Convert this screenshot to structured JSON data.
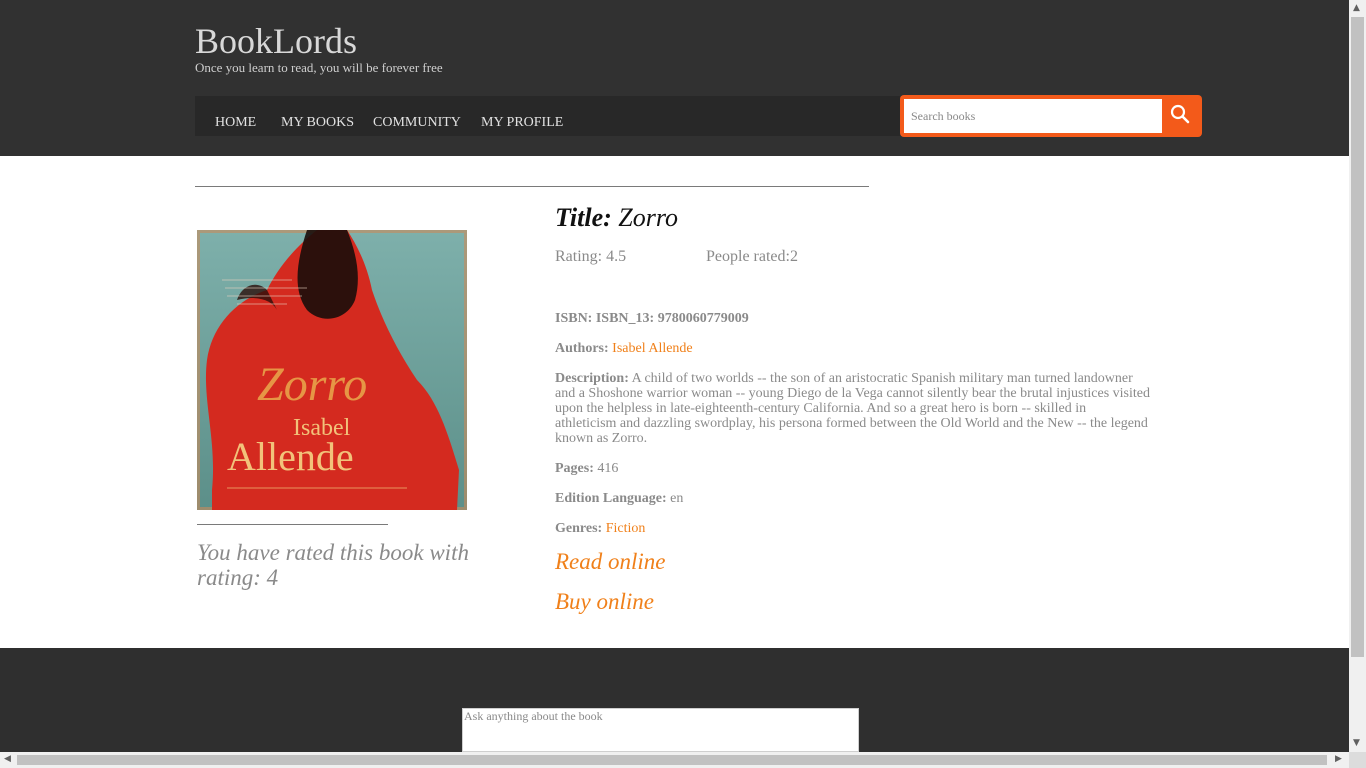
{
  "brand": {
    "name": "BookLords",
    "tagline": "Once you learn to read, you will be forever free"
  },
  "nav": {
    "items": [
      {
        "label": "HOME"
      },
      {
        "label": "MY BOOKS"
      },
      {
        "label": "COMMUNITY"
      },
      {
        "label": "MY PROFILE"
      }
    ]
  },
  "search": {
    "placeholder": "Search books",
    "icon": "search-icon"
  },
  "book": {
    "title_label": "Title:",
    "title": "Zorro",
    "rating": "Rating: 4.5",
    "people_rated": "People rated:2",
    "isbn": "ISBN: ISBN_13: 9780060779009",
    "authors_label": "Authors:",
    "authors": "Isabel Allende",
    "description_label": "Description:",
    "description": "A child of two worlds -- the son of an aristocratic Spanish military man turned landowner and a Shoshone warrior woman -- young Diego de la Vega cannot silently bear the brutal injustices visited upon the helpless in late-eighteenth-century California. And so a great hero is born -- skilled in athleticism and dazzling swordplay, his persona formed between the Old World and the New -- the legend known as Zorro.",
    "pages_label": "Pages:",
    "pages": "416",
    "language_label": "Edition Language:",
    "language": "en",
    "genres_label": "Genres:",
    "genres": "Fiction",
    "read_online": "Read online",
    "buy_online": "Buy online",
    "user_rating_msg": "You have rated this book with rating: 4"
  },
  "cover": {
    "text_author_first": "Isabel",
    "text_author_last": "Allende",
    "text_title": "Zorro",
    "colors": {
      "background": "#6fa3a0",
      "dress": "#d42a1f",
      "text": "#e8a24a"
    }
  },
  "footer": {
    "ask_placeholder": "Ask anything about the book"
  },
  "colors": {
    "header_bg": "#313131",
    "accent": "#f35a1a",
    "link": "#f0801a"
  }
}
